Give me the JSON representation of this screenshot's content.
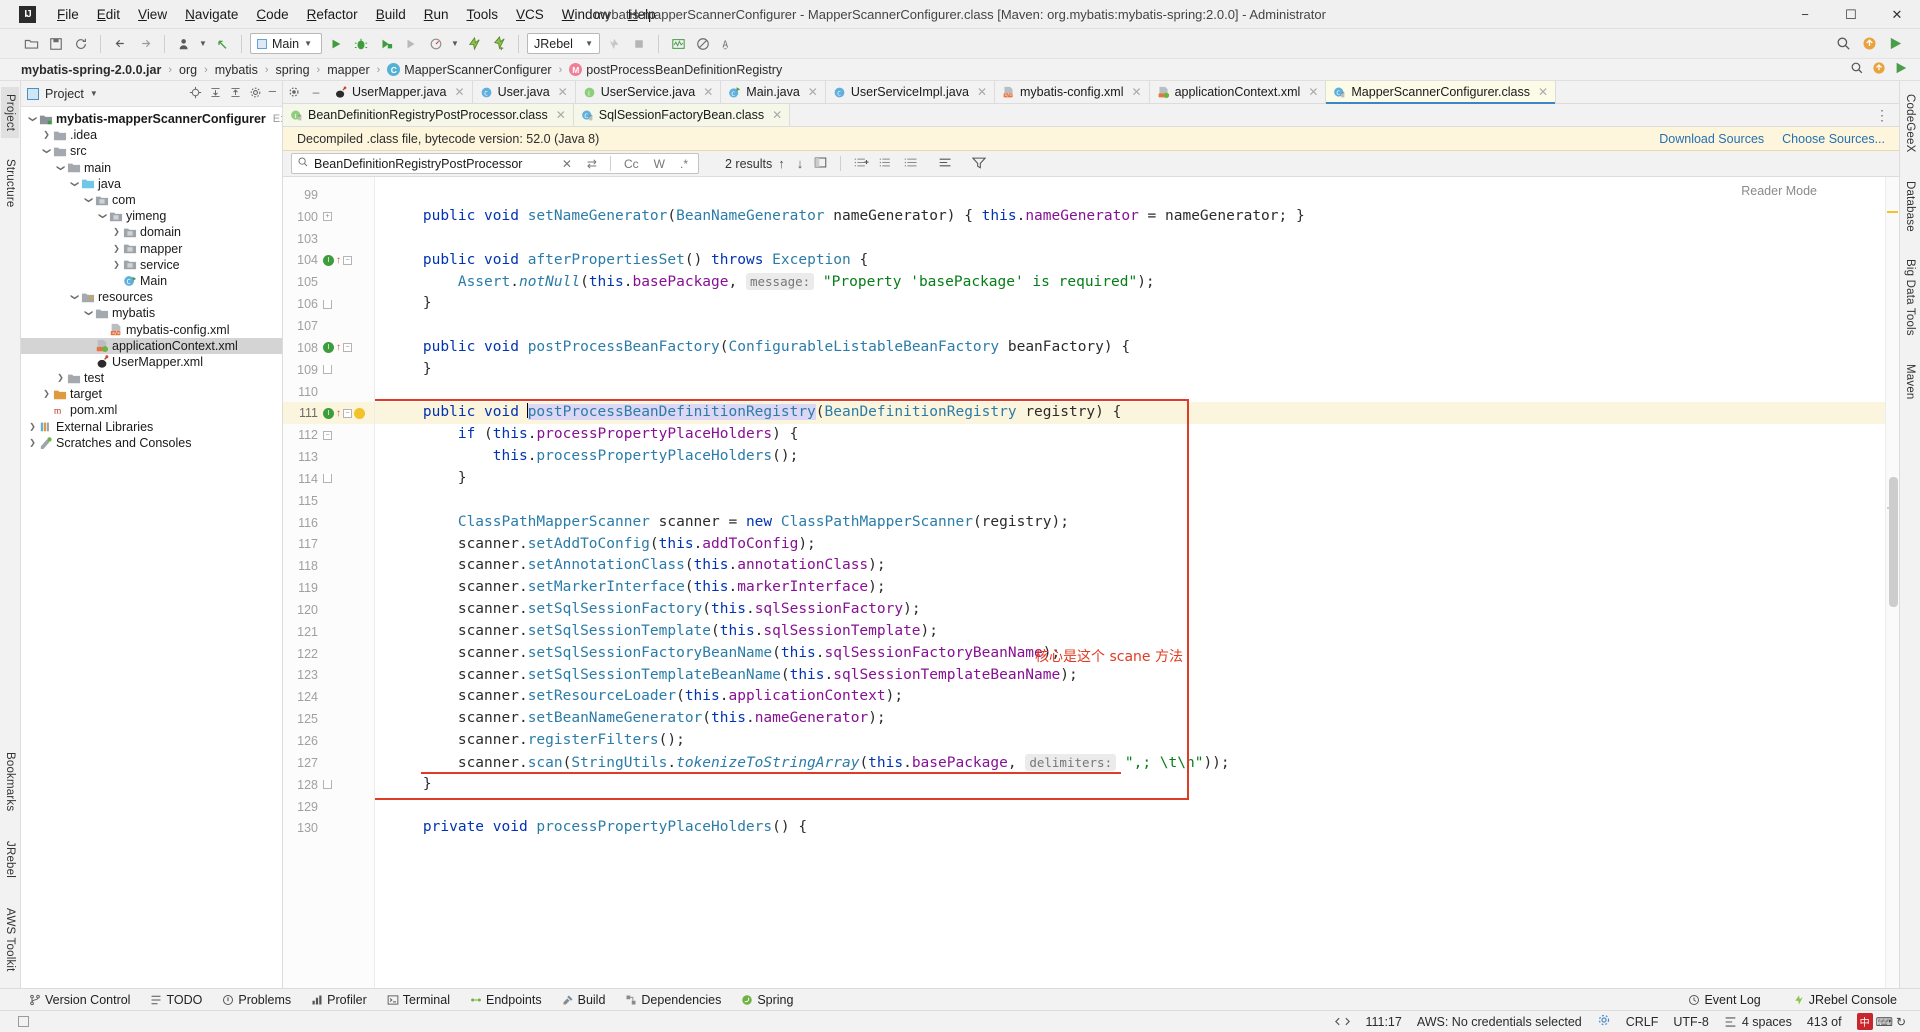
{
  "titlebar": {
    "logo": "IJ",
    "title": "mybatis-mapperScannerConfigurer - MapperScannerConfigurer.class [Maven: org.mybatis:mybatis-spring:2.0.0] - Administrator",
    "menus": [
      "File",
      "Edit",
      "View",
      "Navigate",
      "Code",
      "Refactor",
      "Build",
      "Run",
      "Tools",
      "VCS",
      "Window",
      "Help"
    ],
    "minimize": "−",
    "maximize": "☐",
    "close": "✕"
  },
  "toolbar": {
    "run_config": "Main",
    "jrebel": "JRebel",
    "icons": [
      "open-folder-icon",
      "save-all-icon",
      "sync-icon",
      "back-icon",
      "forward-icon",
      "profile-icon",
      "undo-icon",
      "run-icon",
      "debug-icon",
      "run-coverage-icon",
      "profiler-icon",
      "attach-icon",
      "jrebel-run-icon",
      "jrebel-debug-icon",
      "stop-icon",
      "monitor-icon",
      "disable-icon",
      "search-everywhere-icon",
      "plugins-icon",
      "play-icon"
    ]
  },
  "breadcrumb": {
    "items": [
      {
        "label": "mybatis-spring-2.0.0.jar",
        "bold": true,
        "icon": ""
      },
      {
        "label": "org",
        "bold": false,
        "icon": ""
      },
      {
        "label": "mybatis",
        "bold": false,
        "icon": ""
      },
      {
        "label": "spring",
        "bold": false,
        "icon": ""
      },
      {
        "label": "mapper",
        "bold": false,
        "icon": ""
      },
      {
        "label": "MapperScannerConfigurer",
        "bold": false,
        "icon": "c"
      },
      {
        "label": "postProcessBeanDefinitionRegistry",
        "bold": false,
        "icon": "m"
      }
    ],
    "separator": "›"
  },
  "left_strip": {
    "tabs": [
      "Project",
      "Structure"
    ],
    "bottom_tabs": [
      "Bookmarks",
      "JRebel",
      "AWS Toolkit"
    ]
  },
  "right_strip": {
    "tabs": [
      "CodeGeeX",
      "Database",
      "Big Data Tools",
      "Maven"
    ]
  },
  "project_panel": {
    "title": "Project",
    "caret": "▾",
    "actions": [
      "locate-icon",
      "expand-all-icon",
      "collapse-all-icon",
      "settings-icon",
      "hide-icon"
    ],
    "tree": [
      {
        "depth": 0,
        "arrow": "down",
        "icon": "module",
        "label": "mybatis-mapperScannerConfigurer",
        "bold": true,
        "path": "E:\\mybati",
        "selected": false
      },
      {
        "depth": 1,
        "arrow": "right",
        "icon": "folder",
        "label": ".idea",
        "bold": false,
        "path": "",
        "selected": false
      },
      {
        "depth": 1,
        "arrow": "down",
        "icon": "folder",
        "label": "src",
        "bold": false,
        "path": "",
        "selected": false
      },
      {
        "depth": 2,
        "arrow": "down",
        "icon": "folder",
        "label": "main",
        "bold": false,
        "path": "",
        "selected": false
      },
      {
        "depth": 3,
        "arrow": "down",
        "icon": "source-folder",
        "label": "java",
        "bold": false,
        "path": "",
        "selected": false
      },
      {
        "depth": 4,
        "arrow": "down",
        "icon": "package",
        "label": "com",
        "bold": false,
        "path": "",
        "selected": false
      },
      {
        "depth": 5,
        "arrow": "down",
        "icon": "package",
        "label": "yimeng",
        "bold": false,
        "path": "",
        "selected": false
      },
      {
        "depth": 6,
        "arrow": "right",
        "icon": "package",
        "label": "domain",
        "bold": false,
        "path": "",
        "selected": false
      },
      {
        "depth": 6,
        "arrow": "right",
        "icon": "package",
        "label": "mapper",
        "bold": false,
        "path": "",
        "selected": false
      },
      {
        "depth": 6,
        "arrow": "right",
        "icon": "package",
        "label": "service",
        "bold": false,
        "path": "",
        "selected": false
      },
      {
        "depth": 6,
        "arrow": "none",
        "icon": "java-class-run",
        "label": "Main",
        "bold": false,
        "path": "",
        "selected": false
      },
      {
        "depth": 3,
        "arrow": "down",
        "icon": "resource-folder",
        "label": "resources",
        "bold": false,
        "path": "",
        "selected": false
      },
      {
        "depth": 4,
        "arrow": "down",
        "icon": "folder",
        "label": "mybatis",
        "bold": false,
        "path": "",
        "selected": false
      },
      {
        "depth": 5,
        "arrow": "none",
        "icon": "xml",
        "label": "mybatis-config.xml",
        "bold": false,
        "path": "",
        "selected": false
      },
      {
        "depth": 4,
        "arrow": "none",
        "icon": "spring-xml",
        "label": "applicationContext.xml",
        "bold": false,
        "path": "",
        "selected": true
      },
      {
        "depth": 4,
        "arrow": "none",
        "icon": "mybatis-xml",
        "label": "UserMapper.xml",
        "bold": false,
        "path": "",
        "selected": false
      },
      {
        "depth": 2,
        "arrow": "right",
        "icon": "folder",
        "label": "test",
        "bold": false,
        "path": "",
        "selected": false
      },
      {
        "depth": 1,
        "arrow": "right",
        "icon": "target-folder",
        "label": "target",
        "bold": false,
        "path": "",
        "selected": false
      },
      {
        "depth": 1,
        "arrow": "none",
        "icon": "maven",
        "label": "pom.xml",
        "bold": false,
        "path": "",
        "selected": false
      },
      {
        "depth": 0,
        "arrow": "right",
        "icon": "libraries",
        "label": "External Libraries",
        "bold": false,
        "path": "",
        "selected": false
      },
      {
        "depth": 0,
        "arrow": "right",
        "icon": "scratches",
        "label": "Scratches and Consoles",
        "bold": false,
        "path": "",
        "selected": false
      }
    ]
  },
  "editor_tabs_row1": [
    {
      "label": "UserMapper.java",
      "icon": "mybatis-icon",
      "style": "plain"
    },
    {
      "label": "User.java",
      "icon": "class-icon",
      "style": "plain"
    },
    {
      "label": "UserService.java",
      "icon": "interface-icon",
      "style": "plain"
    },
    {
      "label": "Main.java",
      "icon": "class-run-icon",
      "style": "plain"
    },
    {
      "label": "UserServiceImpl.java",
      "icon": "class-icon",
      "style": "plain"
    },
    {
      "label": "mybatis-config.xml",
      "icon": "xml-icon",
      "style": "plain"
    },
    {
      "label": "applicationContext.xml",
      "icon": "spring-xml-icon",
      "style": "plain"
    },
    {
      "label": "MapperScannerConfigurer.class",
      "icon": "class-decompiled-icon",
      "style": "active"
    }
  ],
  "editor_tabs_row2": [
    {
      "label": "BeanDefinitionRegistryPostProcessor.class",
      "icon": "interface-decompiled-icon",
      "style": "green"
    },
    {
      "label": "SqlSessionFactoryBean.class",
      "icon": "class-decompiled-icon",
      "style": "green"
    }
  ],
  "notification": {
    "message": "Decompiled .class file, bytecode version: 52.0 (Java 8)",
    "download_sources": "Download Sources",
    "choose_sources": "Choose Sources..."
  },
  "findbar": {
    "query": "BeanDefinitionRegistryPostProcessor",
    "placeholder": "Find",
    "close_icon": "✕",
    "regex_icon": "⇄",
    "match_case": "Cc",
    "words": "W",
    "regex": ".*",
    "results": "2 results",
    "prev_icon": "↑",
    "next_icon": "↓",
    "select_all_icon": "select-all-icon",
    "filter_icon": "filter-icon"
  },
  "editor": {
    "reader_mode": "Reader Mode",
    "annotation_cn": "核心是这个 scane 方法",
    "lines": [
      {
        "num": "99",
        "marks": [],
        "text": ""
      },
      {
        "num": "100",
        "marks": [
          "fold-plus"
        ],
        "text": "    public void setNameGenerator(BeanNameGenerator nameGenerator) { this.nameGenerator = nameGenerator; }"
      },
      {
        "num": "103",
        "marks": [],
        "text": ""
      },
      {
        "num": "104",
        "marks": [
          "run",
          "override",
          "fold-minus"
        ],
        "text": "    public void afterPropertiesSet() throws Exception {"
      },
      {
        "num": "105",
        "marks": [],
        "text": "        Assert.notNull(this.basePackage, message: \"Property 'basePackage' is required\");"
      },
      {
        "num": "106",
        "marks": [
          "fold-end"
        ],
        "text": "    }"
      },
      {
        "num": "107",
        "marks": [],
        "text": ""
      },
      {
        "num": "108",
        "marks": [
          "run",
          "override",
          "fold-minus"
        ],
        "text": "    public void postProcessBeanFactory(ConfigurableListableBeanFactory beanFactory) {"
      },
      {
        "num": "109",
        "marks": [
          "fold-end"
        ],
        "text": "    }"
      },
      {
        "num": "110",
        "marks": [],
        "text": ""
      },
      {
        "num": "111",
        "marks": [
          "run",
          "override",
          "fold-minus",
          "bulb"
        ],
        "text": "    public void postProcessBeanDefinitionRegistry(BeanDefinitionRegistry registry) {"
      },
      {
        "num": "112",
        "marks": [
          "fold-minus"
        ],
        "text": "        if (this.processPropertyPlaceHolders) {"
      },
      {
        "num": "113",
        "marks": [],
        "text": "            this.processPropertyPlaceHolders();"
      },
      {
        "num": "114",
        "marks": [
          "fold-end"
        ],
        "text": "        }"
      },
      {
        "num": "115",
        "marks": [],
        "text": ""
      },
      {
        "num": "116",
        "marks": [],
        "text": "        ClassPathMapperScanner scanner = new ClassPathMapperScanner(registry);"
      },
      {
        "num": "117",
        "marks": [],
        "text": "        scanner.setAddToConfig(this.addToConfig);"
      },
      {
        "num": "118",
        "marks": [],
        "text": "        scanner.setAnnotationClass(this.annotationClass);"
      },
      {
        "num": "119",
        "marks": [],
        "text": "        scanner.setMarkerInterface(this.markerInterface);"
      },
      {
        "num": "120",
        "marks": [],
        "text": "        scanner.setSqlSessionFactory(this.sqlSessionFactory);"
      },
      {
        "num": "121",
        "marks": [],
        "text": "        scanner.setSqlSessionTemplate(this.sqlSessionTemplate);"
      },
      {
        "num": "122",
        "marks": [],
        "text": "        scanner.setSqlSessionFactoryBeanName(this.sqlSessionFactoryBeanName);"
      },
      {
        "num": "123",
        "marks": [],
        "text": "        scanner.setSqlSessionTemplateBeanName(this.sqlSessionTemplateBeanName);"
      },
      {
        "num": "124",
        "marks": [],
        "text": "        scanner.setResourceLoader(this.applicationContext);"
      },
      {
        "num": "125",
        "marks": [],
        "text": "        scanner.setBeanNameGenerator(this.nameGenerator);"
      },
      {
        "num": "126",
        "marks": [],
        "text": "        scanner.registerFilters();"
      },
      {
        "num": "127",
        "marks": [],
        "text": "        scanner.scan(StringUtils.tokenizeToStringArray(this.basePackage, delimiters: \",; \\t\\n\"));"
      },
      {
        "num": "128",
        "marks": [
          "fold-end"
        ],
        "text": "    }"
      },
      {
        "num": "129",
        "marks": [],
        "text": ""
      },
      {
        "num": "130",
        "marks": [],
        "text": "    private void processPropertyPlaceHolders() {"
      }
    ]
  },
  "bottom_bar": {
    "items": [
      {
        "label": "Version Control",
        "icon": "branch-icon"
      },
      {
        "label": "TODO",
        "icon": "todo-icon"
      },
      {
        "label": "Problems",
        "icon": "problems-icon"
      },
      {
        "label": "Profiler",
        "icon": "profiler-icon"
      },
      {
        "label": "Terminal",
        "icon": "terminal-icon"
      },
      {
        "label": "Endpoints",
        "icon": "endpoints-icon"
      },
      {
        "label": "Build",
        "icon": "build-icon"
      },
      {
        "label": "Dependencies",
        "icon": "dependencies-icon"
      },
      {
        "label": "Spring",
        "icon": "spring-icon"
      }
    ],
    "right": [
      {
        "label": "Event Log",
        "icon": "event-log-icon"
      },
      {
        "label": "JRebel Console",
        "icon": "jrebel-icon"
      }
    ]
  },
  "status_bar": {
    "caret_position": "111:17",
    "aws": "AWS: No credentials selected",
    "line_separator": "CRLF",
    "encoding": "UTF-8",
    "indent": "4 spaces",
    "memory": "413 of",
    "branch_icon": "git-icon",
    "lock_icon": "lock-icon",
    "gear_icon": "gear-icon",
    "ime_label": "中"
  },
  "colors": {
    "accent": "#3b86c7",
    "annotation_red": "#e03b24",
    "keyword": "#0033b3",
    "type": "#2b7ca8",
    "field": "#871094",
    "string": "#067d17",
    "notification_bg": "#fdf6dd",
    "selection": "#dcd7f5"
  }
}
